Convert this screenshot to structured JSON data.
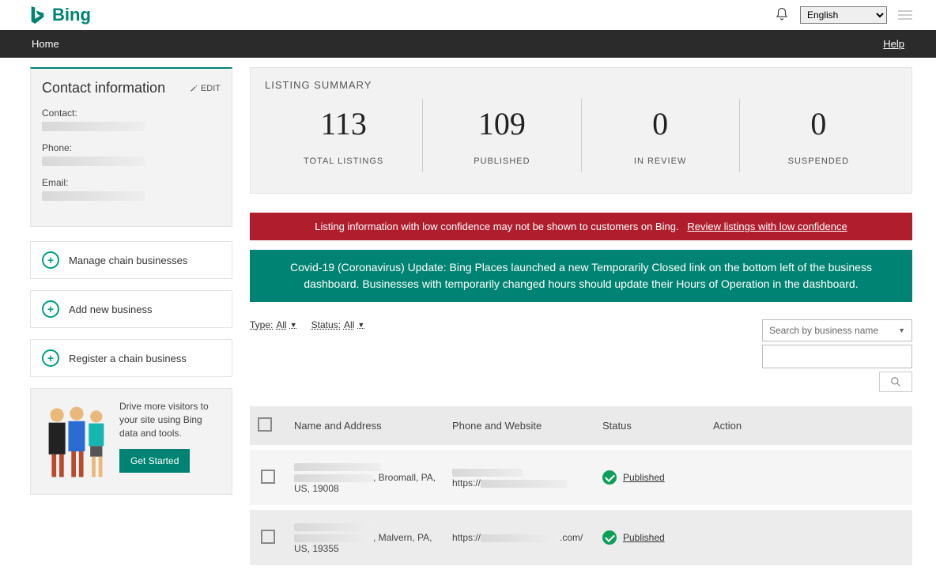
{
  "header": {
    "brand": "Bing",
    "language": "English"
  },
  "nav": {
    "home": "Home",
    "help": "Help"
  },
  "contact": {
    "title": "Contact information",
    "edit": "EDIT",
    "contact_label": "Contact:",
    "phone_label": "Phone:",
    "email_label": "Email:"
  },
  "side_actions": {
    "manage": "Manage chain businesses",
    "add": "Add new business",
    "register": "Register a chain business"
  },
  "promo": {
    "text": "Drive more visitors to your site using Bing data and tools.",
    "cta": "Get Started"
  },
  "summary": {
    "title": "LISTING SUMMARY",
    "stats": [
      {
        "value": "113",
        "label": "TOTAL LISTINGS"
      },
      {
        "value": "109",
        "label": "PUBLISHED"
      },
      {
        "value": "0",
        "label": "IN REVIEW"
      },
      {
        "value": "0",
        "label": "SUSPENDED"
      }
    ]
  },
  "alerts": {
    "red_text": "Listing information with low confidence may not be shown to customers on Bing.",
    "red_link": "Review listings with low confidence",
    "teal": "Covid-19 (Coronavirus) Update: Bing Places launched a new Temporarily Closed link on the bottom left of the business dashboard. Businesses with temporarily changed hours should update their Hours of Operation in the dashboard."
  },
  "filters": {
    "type_label": "Type:",
    "type_value": "All",
    "status_label": "Status:",
    "status_value": "All",
    "search_placeholder": "Search by business name"
  },
  "table": {
    "headers": {
      "name": "Name and Address",
      "phone": "Phone and Website",
      "status": "Status",
      "action": "Action"
    },
    "rows": [
      {
        "addr_suffix": ", Broomall, PA, US, 19008",
        "site_prefix": "https://",
        "status": "Published"
      },
      {
        "addr_suffix": ", Malvern, PA, US, 19355",
        "site_prefix": "https://",
        "site_suffix": ".com/",
        "status": "Published"
      }
    ]
  }
}
